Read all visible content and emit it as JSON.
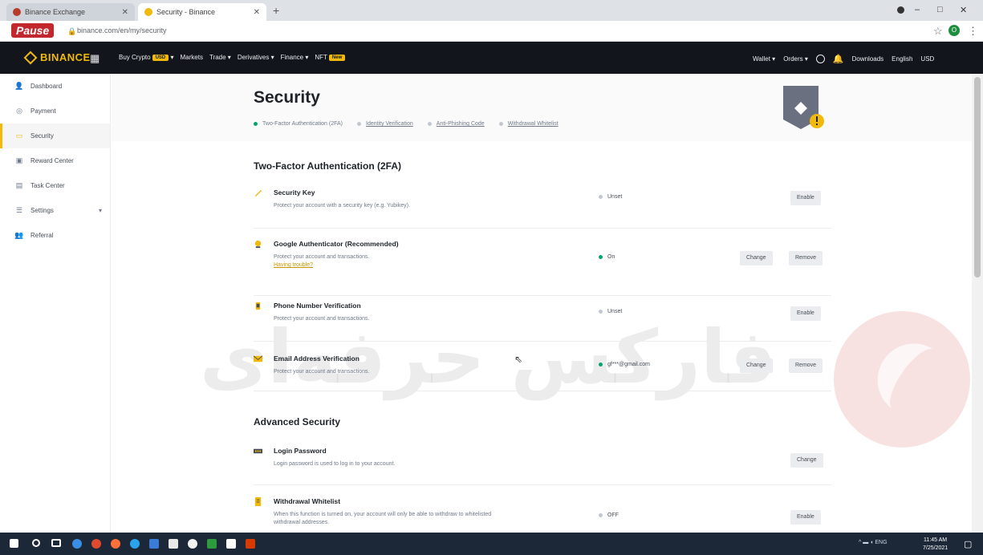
{
  "browser": {
    "tabs": [
      {
        "title": "Binance Exchange"
      },
      {
        "title": "Security - Binance"
      }
    ],
    "url": "binance.com/en/my/security",
    "pause_label": "Pause",
    "profile_initial": "O"
  },
  "header": {
    "logo": "BINANCE",
    "nav": [
      {
        "label": "Buy Crypto",
        "badge": "USD"
      },
      {
        "label": "Markets",
        "badge": ""
      },
      {
        "label": "Trade",
        "badge": ""
      },
      {
        "label": "Derivatives",
        "badge": ""
      },
      {
        "label": "Finance",
        "badge": ""
      },
      {
        "label": "NFT",
        "badge": "New"
      }
    ],
    "right": {
      "wallet": "Wallet",
      "orders": "Orders",
      "downloads": "Downloads",
      "language": "English",
      "currency": "USD"
    }
  },
  "sidebar": {
    "items": [
      {
        "label": "Dashboard",
        "icon": "person-icon"
      },
      {
        "label": "Payment",
        "icon": "payment-icon"
      },
      {
        "label": "Security",
        "icon": "security-icon"
      },
      {
        "label": "Reward Center",
        "icon": "reward-icon"
      },
      {
        "label": "Task Center",
        "icon": "task-icon"
      },
      {
        "label": "Settings",
        "icon": "settings-icon"
      },
      {
        "label": "Referral",
        "icon": "referral-icon"
      }
    ],
    "active_index": 2
  },
  "page": {
    "title": "Security",
    "steps": [
      {
        "label": "Two-Factor Authentication (2FA)",
        "done": true
      },
      {
        "label": "Identity Verification",
        "done": false
      },
      {
        "label": "Anti-Phishing Code",
        "done": false
      },
      {
        "label": "Withdrawal Whitelist",
        "done": false
      }
    ]
  },
  "twofa": {
    "title": "Two-Factor Authentication (2FA)",
    "items": [
      {
        "title": "Security Key",
        "desc": "Protect your account with a security key (e.g. Yubikey).",
        "status": "Unset",
        "buttons": [
          "Enable"
        ]
      },
      {
        "title": "Google Authenticator (Recommended)",
        "desc": "Protect your account and transactions.",
        "link": "Having trouble?",
        "status": "On",
        "buttons": [
          "Change",
          "Remove"
        ]
      },
      {
        "title": "Phone Number Verification",
        "desc": "Protect your account and transactions.",
        "status": "Unset",
        "buttons": [
          "Enable"
        ]
      },
      {
        "title": "Email Address Verification",
        "desc": "Protect your account and transactions.",
        "status": "gf***@gmail.com",
        "buttons": [
          "Change",
          "Remove"
        ]
      }
    ]
  },
  "advanced": {
    "title": "Advanced Security",
    "items": [
      {
        "title": "Login Password",
        "desc": "Login password is used to log in to your account.",
        "status": "",
        "buttons": [
          "Change"
        ]
      },
      {
        "title": "Withdrawal Whitelist",
        "desc": "When this function is turned on, your account will only be able to withdraw to whitelisted",
        "desc2": "withdrawal addresses.",
        "status": "OFF",
        "buttons": [
          "Enable"
        ]
      }
    ]
  },
  "watermark": "فارکس حرفه‌ای",
  "taskbar": {
    "time": "11:45 AM",
    "date": "7/25/2021",
    "lang": "ENG"
  },
  "colors": {
    "brand": "#f0b90b",
    "header_bg": "#12161c",
    "ok": "#03a66d"
  }
}
